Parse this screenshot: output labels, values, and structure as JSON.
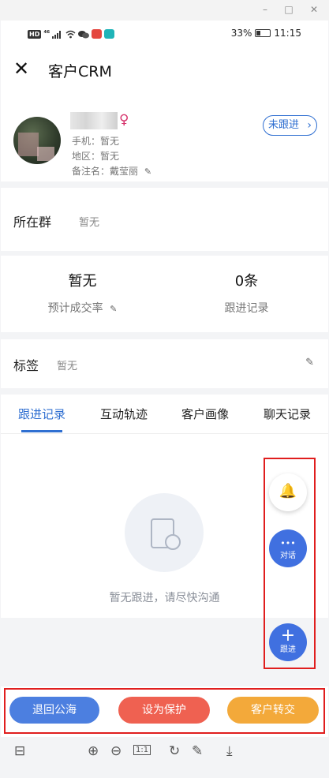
{
  "window": {
    "minimize": "–",
    "maximize": "□",
    "close": "✕"
  },
  "statusbar": {
    "hd": "HD",
    "signal": "⁴⁶",
    "battery_text": "33%",
    "battery_level": 0.33,
    "time": "11:15"
  },
  "header": {
    "close_glyph": "✕",
    "title": "客户CRM"
  },
  "profile": {
    "gender_glyph": "♀",
    "phone": "手机：暂无",
    "region": "地区：暂无",
    "remark_name": "备注名：戴莹丽",
    "edit_glyph": "✎",
    "status_label": "未跟进",
    "status_chevron": "›"
  },
  "group": {
    "label": "所在群",
    "value": "暂无"
  },
  "stats": {
    "deal_rate_value": "暂无",
    "deal_rate_label": "预计成交率",
    "records_value": "0条",
    "records_label": "跟进记录"
  },
  "tags": {
    "label": "标签",
    "value": "暂无"
  },
  "tabs": [
    {
      "label": "跟进记录"
    },
    {
      "label": "互动轨迹"
    },
    {
      "label": "客户画像"
    },
    {
      "label": "聊天记录"
    }
  ],
  "empty": {
    "text": "暂无跟进，请尽快沟通"
  },
  "fab": {
    "bell_glyph": "🔔",
    "chat_glyph": "•••",
    "chat_label": "对话",
    "follow_glyph": "+",
    "follow_label": "跟进"
  },
  "actions": {
    "return_label": "退回公海",
    "protect_label": "设为保护",
    "transfer_label": "客户转交"
  },
  "toolbar": {
    "panel_glyph": "⊟",
    "zoom_in_glyph": "⊕",
    "zoom_out_glyph": "⊖",
    "actual_size_glyph": "1:1",
    "rotate_glyph": "↻",
    "edit_glyph": "✎",
    "download_glyph": "⤓"
  },
  "colors": {
    "accent": "#2f6fd1",
    "return": "#4c7fe0",
    "protect": "#ef6151",
    "transfer": "#f3a93a",
    "highlight_box": "#e01e1e"
  }
}
